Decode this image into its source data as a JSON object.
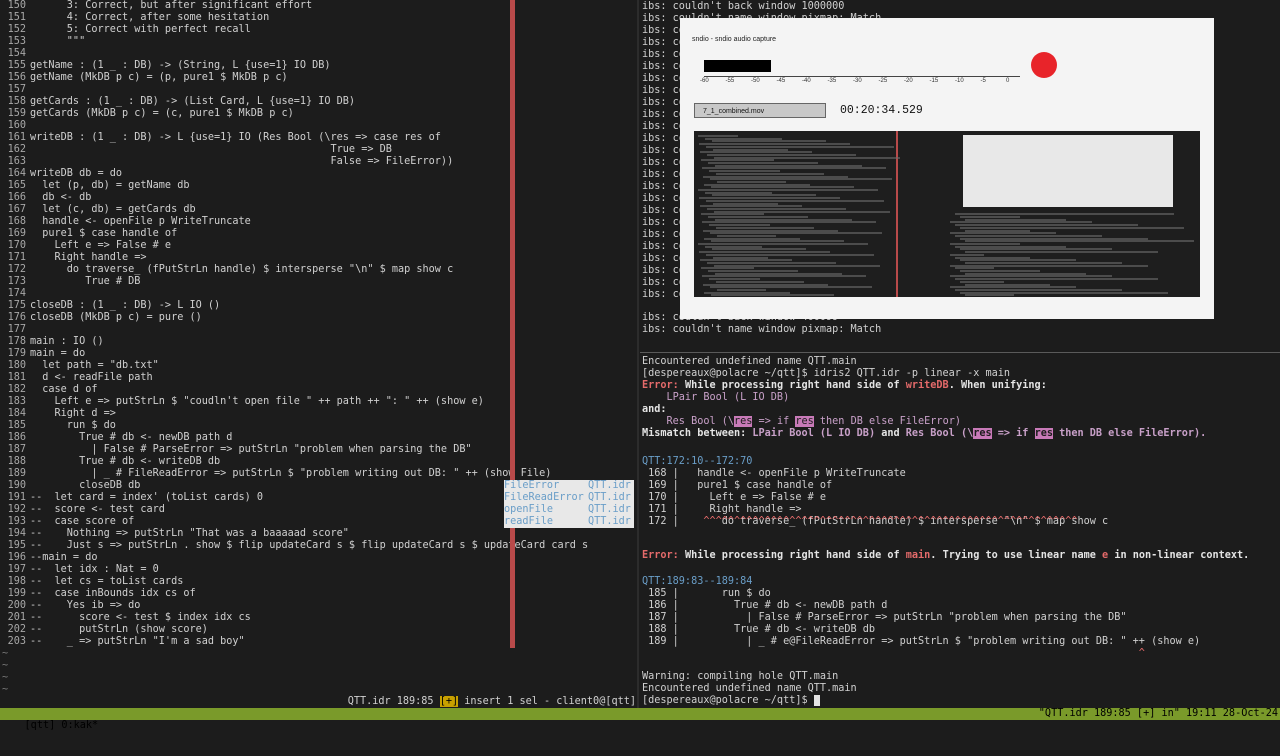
{
  "editor": {
    "lines": [
      {
        "n": "150",
        "t": "      3: Correct, but after significant effort"
      },
      {
        "n": "151",
        "t": "      4: Correct, after some hesitation"
      },
      {
        "n": "152",
        "t": "      5: Correct with perfect recall"
      },
      {
        "n": "153",
        "t": "      \"\"\""
      },
      {
        "n": "154",
        "t": ""
      },
      {
        "n": "155",
        "t": "getName : (1 _ : DB) -> (String, L {use=1} IO DB)"
      },
      {
        "n": "156",
        "t": "getName (MkDB p c) = (p, pure1 $ MkDB p c)"
      },
      {
        "n": "157",
        "t": ""
      },
      {
        "n": "158",
        "t": "getCards : (1 _ : DB) -> (List Card, L {use=1} IO DB)"
      },
      {
        "n": "159",
        "t": "getCards (MkDB p c) = (c, pure1 $ MkDB p c)"
      },
      {
        "n": "160",
        "t": ""
      },
      {
        "n": "161",
        "t": "writeDB : (1 _ : DB) -> L {use=1} IO (Res Bool (\\res => case res of"
      },
      {
        "n": "162",
        "t": "                                                 True => DB"
      },
      {
        "n": "163",
        "t": "                                                 False => FileError))"
      },
      {
        "n": "164",
        "t": "writeDB db = do"
      },
      {
        "n": "165",
        "t": "  let (p, db) = getName db"
      },
      {
        "n": "166",
        "t": "  db <- db"
      },
      {
        "n": "167",
        "t": "  let (c, db) = getCards db"
      },
      {
        "n": "168",
        "t": "  handle <- openFile p WriteTruncate"
      },
      {
        "n": "169",
        "t": "  pure1 $ case handle of"
      },
      {
        "n": "170",
        "t": "    Left e => False # e"
      },
      {
        "n": "171",
        "t": "    Right handle =>"
      },
      {
        "n": "172",
        "t": "      do traverse_ (fPutStrLn handle) $ intersperse \"\\n\" $ map show c"
      },
      {
        "n": "173",
        "t": "         True # DB"
      },
      {
        "n": "174",
        "t": ""
      },
      {
        "n": "175",
        "t": "closeDB : (1 _ : DB) -> L IO ()"
      },
      {
        "n": "176",
        "t": "closeDB (MkDB p c) = pure ()"
      },
      {
        "n": "177",
        "t": ""
      },
      {
        "n": "178",
        "t": "main : IO ()"
      },
      {
        "n": "179",
        "t": "main = do"
      },
      {
        "n": "180",
        "t": "  let path = \"db.txt\""
      },
      {
        "n": "181",
        "t": "  d <- readFile path"
      },
      {
        "n": "182",
        "t": "  case d of"
      },
      {
        "n": "183",
        "t": "    Left e => putStrLn $ \"coudln't open file \" ++ path ++ \": \" ++ (show e)"
      },
      {
        "n": "184",
        "t": "    Right d =>"
      },
      {
        "n": "185",
        "t": "      run $ do"
      },
      {
        "n": "186",
        "t": "        True # db <- newDB path d"
      },
      {
        "n": "187",
        "t": "          | False # ParseError => putStrLn \"problem when parsing the DB\""
      },
      {
        "n": "188",
        "t": "        True # db <- writeDB db"
      },
      {
        "n": "189",
        "t": "          | _ # FileReadError => putStrLn $ \"problem writing out DB: \" ++ (show File)"
      },
      {
        "n": "190",
        "t": "        closeDB db"
      },
      {
        "n": "191",
        "t": "--  let card = index' (toList cards) 0"
      },
      {
        "n": "192",
        "t": "--  score <- test card"
      },
      {
        "n": "193",
        "t": "--  case score of"
      },
      {
        "n": "194",
        "t": "--    Nothing => putStrLn \"That was a baaaaad score\""
      },
      {
        "n": "195",
        "t": "--    Just s => putStrLn . show $ flip updateCard s $ flip updateCard s $ updateCard card s"
      },
      {
        "n": "196",
        "t": "--main = do"
      },
      {
        "n": "197",
        "t": "--  let idx : Nat = 0"
      },
      {
        "n": "198",
        "t": "--  let cs = toList cards"
      },
      {
        "n": "199",
        "t": "--  case inBounds idx cs of"
      },
      {
        "n": "200",
        "t": "--    Yes ib => do"
      },
      {
        "n": "201",
        "t": "--      score <- test $ index idx cs"
      },
      {
        "n": "202",
        "t": "--      putStrLn (show score)"
      },
      {
        "n": "203",
        "t": "--    _ => putStrLn \"I'm a sad boy\""
      }
    ],
    "tildes": [
      "~",
      "~",
      "~",
      "~"
    ],
    "completions": [
      {
        "name": "FileError",
        "src": "QTT.idr"
      },
      {
        "name": "FileReadError",
        "src": "QTT.idr"
      },
      {
        "name": "openFile",
        "src": "QTT.idr"
      },
      {
        "name": "readFile",
        "src": "QTT.idr"
      }
    ],
    "modeline": {
      "file": "QTT.idr 189:85 ",
      "modified": "[+]",
      "rest": " insert 1 sel - client0@[qtt]"
    }
  },
  "term_top": {
    "lines": [
      "ibs: couldn't back window 1000000",
      "ibs: couldn't name window pixmap: Match",
      "ibs: co",
      "ibs: co",
      "ibs: co",
      "ibs: co",
      "ibs: co",
      "ibs: co",
      "ibs: co",
      "ibs: co",
      "ibs: co",
      "ibs: co",
      "ibs: co",
      "ibs: co",
      "ibs: co",
      "ibs: co",
      "ibs: co",
      "ibs: co",
      "ibs: co",
      "ibs: co",
      "ibs: co",
      "ibs: co",
      "ibs: co",
      "ibs: co",
      "ibs: co",
      "ibs: couldn't back window 400099",
      "ibs: couldn't name window pixmap: Match"
    ],
    "capture": {
      "title": "sndio - sndio audio capture",
      "ticks": [
        "-60",
        "-55",
        "-50",
        "-45",
        "-40",
        "-35",
        "-30",
        "-25",
        "-20",
        "-15",
        "-10",
        "-5",
        "0"
      ],
      "filename": "7_1_combined.mov",
      "timecode": "00:20:34.529"
    }
  },
  "term_bot": {
    "l1": "Encountered undefined name QTT.main",
    "prompt1": "[despereaux@polacre ~/qtt]$ idris2 QTT.idr -p linear -x main",
    "err1a": "Error:",
    "err1b": " While processing right hand side of ",
    "err1c": "writeDB",
    "err1d": ". When unifying:",
    "lpair": "    LPair Bool (L IO DB)",
    "and": "and:",
    "res1": "    Res Bool (\\",
    "res2": "res",
    "res3": " => if ",
    "res4": "res",
    "res5": " then DB else FileError)",
    "mm1": "Mismatch between: ",
    "mm2": "LPair Bool (L IO DB)",
    "mm3": " and ",
    "mm4": "Res Bool (\\",
    "mm5": "res",
    "mm6": " => if ",
    "mm7": "res",
    "mm8": " then DB else FileError).",
    "loc1": "QTT:172:10--172:70",
    "src1": [
      " 168 |   handle <- openFile p WriteTruncate",
      " 169 |   pure1 $ case handle of",
      " 170 |     Left e => False # e",
      " 171 |     Right handle =>",
      " 172 |       do traverse_ (fPutStrLn handle) $ intersperse \"\\n\" $ map show c"
    ],
    "carets1": "          ^^^^^^^^^^^^^^^^^^^^^^^^^^^^^^^^^^^^^^^^^^^^^^^^^^^^^^^^^^^^^",
    "err2a": "Error:",
    "err2b": " While processing right hand side of ",
    "err2c": "main",
    "err2d": ". Trying to use linear name ",
    "err2e": "e",
    "err2f": " in non-linear context.",
    "loc2": "QTT:189:83--189:84",
    "src2": [
      " 185 |       run $ do",
      " 186 |         True # db <- newDB path d",
      " 187 |           | False # ParseError => putStrLn \"problem when parsing the DB\"",
      " 188 |         True # db <- writeDB db",
      " 189 |           | _ # e@FileReadError => putStrLn $ \"problem writing out DB: \" ++ (show e)"
    ],
    "caret2": "                                                                                 ^",
    "warn": "Warning: compiling hole QTT.main",
    "l2": "Encountered undefined name QTT.main",
    "prompt2": "[despereaux@polacre ~/qtt]$ "
  },
  "status": {
    "left": "[qtt] 0:kak*",
    "right": "\"QTT.idr 189:85 [+] in\" 19:11 28-Oct-24"
  }
}
